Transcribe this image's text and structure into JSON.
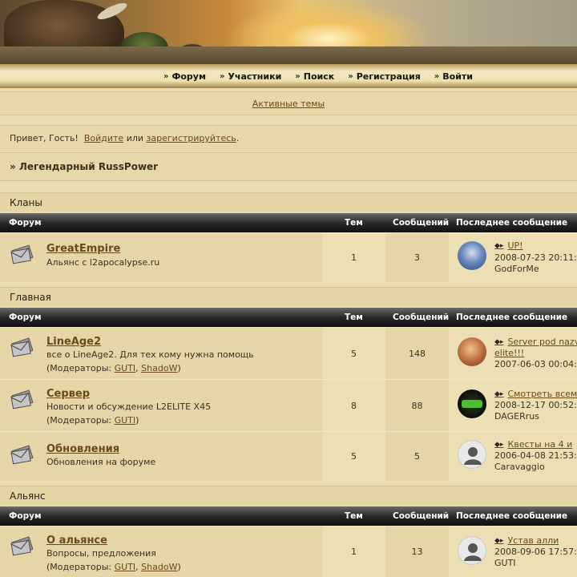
{
  "nav": {
    "items": [
      {
        "label": "Форум"
      },
      {
        "label": "Участники"
      },
      {
        "label": "Поиск"
      },
      {
        "label": "Регистрация"
      },
      {
        "label": "Войти"
      }
    ]
  },
  "active_topics": "Активные темы",
  "greeting": {
    "prefix": "Привет, Гость!",
    "login_link": "Войдите",
    "or": "или",
    "register_link": "зарегистрируйтесь",
    "suffix": "."
  },
  "forum_title": "» Легендарный RussPower",
  "table_headers": {
    "forum": "Форум",
    "topics": "Тем",
    "posts": "Сообщений",
    "last_post": "Последнее сообщение"
  },
  "categories": [
    {
      "name": "Кланы",
      "forums": [
        {
          "title": "GreatEmpire",
          "description": "Альянс с l2apocalypse.ru",
          "topics": "1",
          "posts": "3",
          "last_post": {
            "title": "UP!",
            "date": "2008-07-23 20:11:",
            "author": "GodForMe"
          }
        }
      ]
    },
    {
      "name": "Главная",
      "forums": [
        {
          "title": "LineAge2",
          "description": "все о LineAge2. Для тех кому нужна помощь",
          "moderators_prefix": "(Модераторы:",
          "moderators": [
            "GUTI",
            "ShadoW"
          ],
          "topics": "5",
          "posts": "148",
          "last_post": {
            "title": "Server pod nazv",
            "title2": "elite!!!",
            "date": "2007-06-03 00:04:",
            "author": ""
          }
        },
        {
          "title": "Сервер",
          "description": "Новости и обсуждение L2ELITE X45",
          "moderators_prefix": "(Модераторы:",
          "moderators": [
            "GUTI"
          ],
          "topics": "8",
          "posts": "88",
          "last_post": {
            "title": "Смотреть всем",
            "date": "2008-12-17 00:52:",
            "author": "DAGERrus"
          }
        },
        {
          "title": "Обновления",
          "description": "Обновления на форуме",
          "topics": "5",
          "posts": "5",
          "last_post": {
            "title": "Квесты на 4 и",
            "date": "2006-04-08 21:53:",
            "author": "Caravaggio"
          }
        }
      ]
    },
    {
      "name": "Альянс",
      "forums": [
        {
          "title": "О альянсе",
          "description": "Вопросы, предложения",
          "moderators_prefix": "(Модераторы:",
          "moderators": [
            "GUTI",
            "ShadoW"
          ],
          "topics": "1",
          "posts": "13",
          "last_post": {
            "title": "Устав алли",
            "date": "2008-09-06 17:57:",
            "author": "GUTI"
          }
        }
      ]
    }
  ]
}
